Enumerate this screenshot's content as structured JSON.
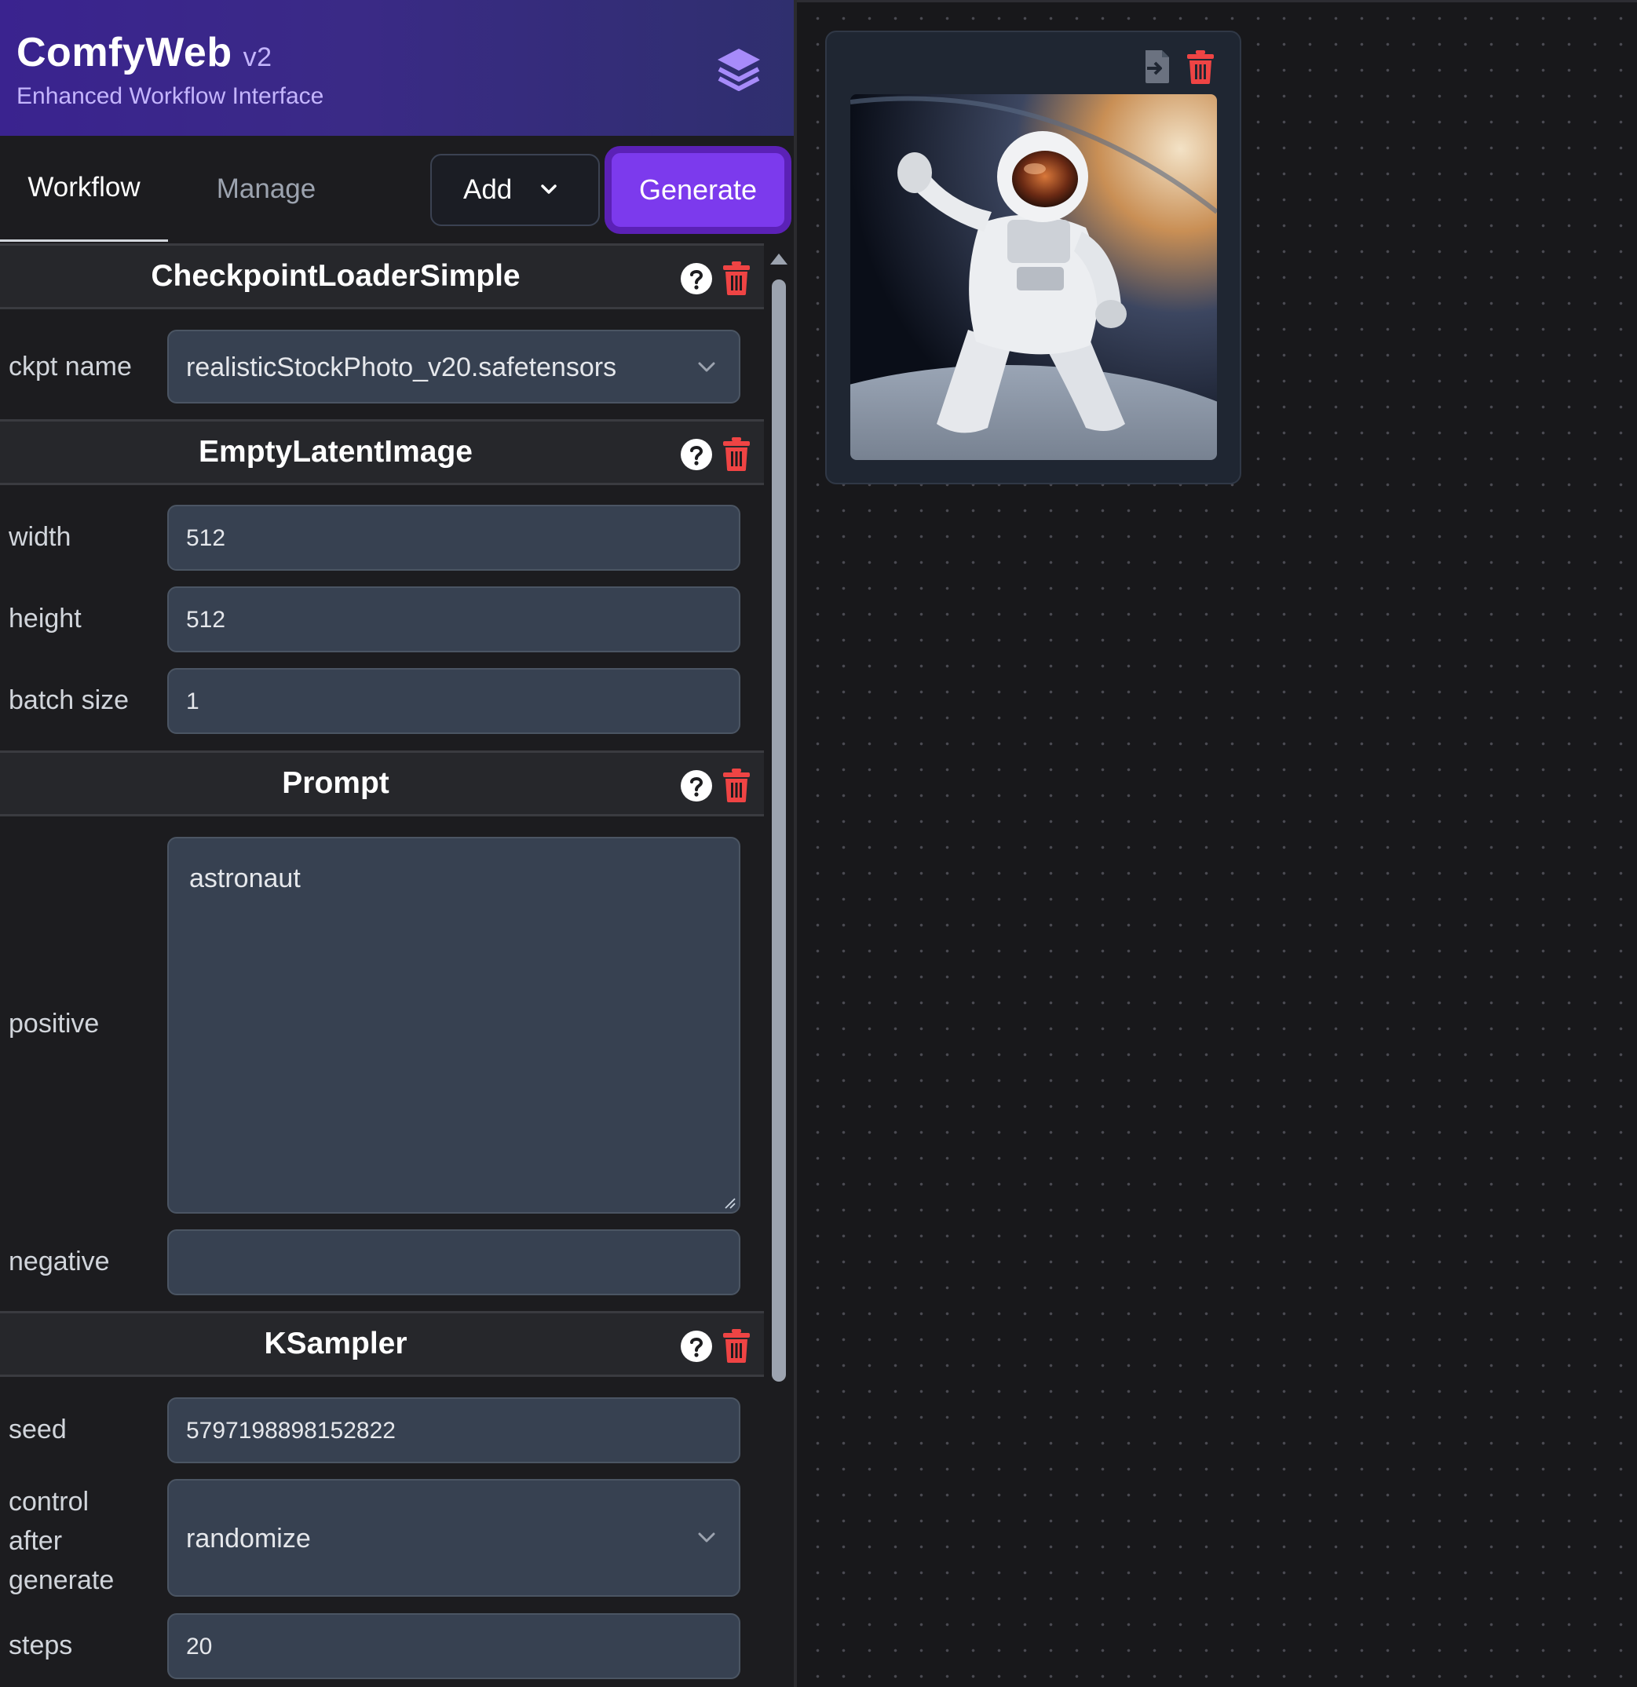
{
  "app": {
    "title": "ComfyWeb",
    "version": "v2",
    "subtitle": "Enhanced Workflow Interface"
  },
  "tabs": [
    {
      "label": "Workflow",
      "active": true
    },
    {
      "label": "Manage",
      "active": false
    }
  ],
  "toolbar": {
    "add_label": "Add",
    "generate_label": "Generate"
  },
  "nodes": {
    "checkpoint": {
      "title": "CheckpointLoaderSimple",
      "ckpt_name_label": "ckpt name",
      "ckpt_name_value": "realisticStockPhoto_v20.safetensors"
    },
    "latent": {
      "title": "EmptyLatentImage",
      "width_label": "width",
      "width_value": "512",
      "height_label": "height",
      "height_value": "512",
      "batch_label": "batch size",
      "batch_value": "1"
    },
    "prompt": {
      "title": "Prompt",
      "positive_label": "positive",
      "positive_value": "astronaut",
      "negative_label": "negative",
      "negative_value": ""
    },
    "ksampler": {
      "title": "KSampler",
      "seed_label": "seed",
      "seed_value": "5797198898152822",
      "control_label_1": "control",
      "control_label_2": "after",
      "control_label_3": "generate",
      "control_value": "randomize",
      "steps_label": "steps",
      "steps_value": "20"
    }
  },
  "icons": {
    "brand": "layers-icon",
    "help": "help-circle-icon",
    "delete": "trash-icon",
    "load": "load-file-icon",
    "dropdown": "chevron-down-icon"
  },
  "colors": {
    "accent": "#7c3aed",
    "accent_border": "#5b21b6",
    "delete_red": "#ef4444",
    "header_gradient_start": "#3a238f",
    "header_gradient_end": "#2f2f6e",
    "field_bg": "#374151"
  },
  "output": {
    "image_subject": "astronaut in space"
  }
}
